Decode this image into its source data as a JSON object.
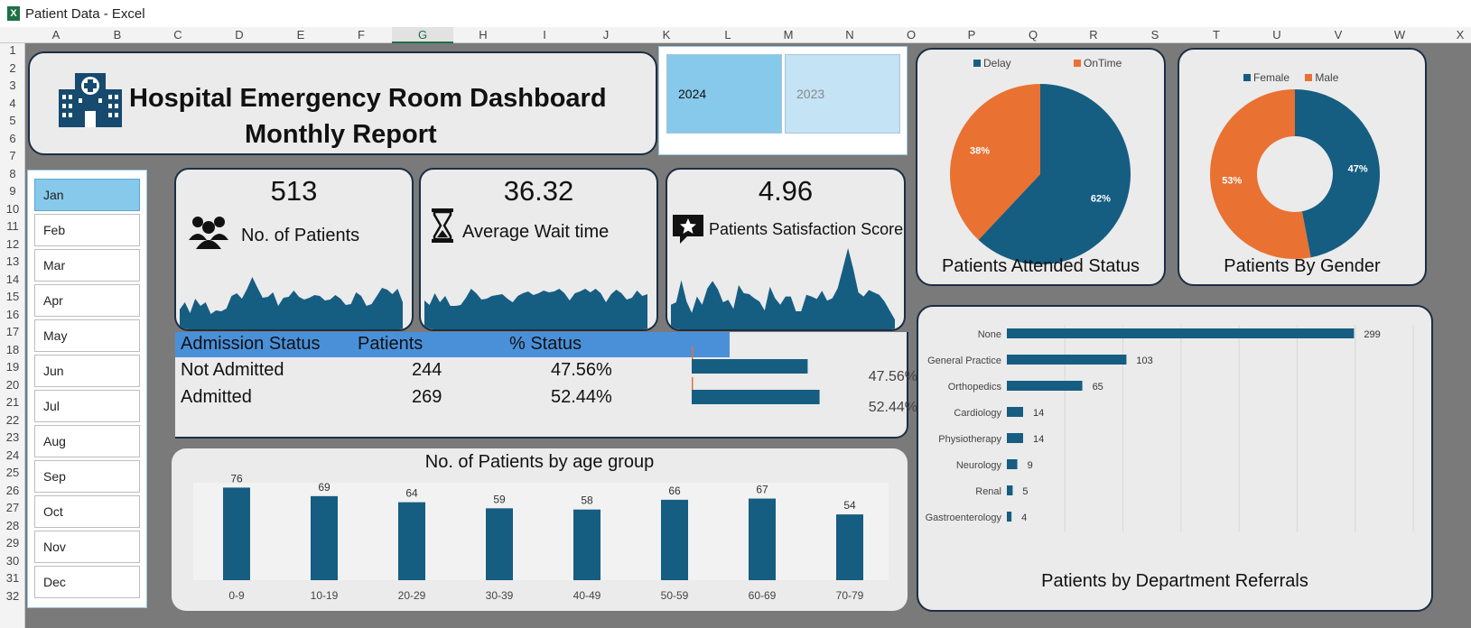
{
  "window": {
    "app_icon": "X",
    "title": "Patient  Data - Excel"
  },
  "columns": [
    "A",
    "B",
    "C",
    "D",
    "E",
    "F",
    "G",
    "H",
    "I",
    "J",
    "K",
    "L",
    "M",
    "N",
    "O",
    "P",
    "Q",
    "R",
    "S",
    "T",
    "U",
    "V",
    "W",
    "X"
  ],
  "rows": [
    "1",
    "2",
    "3",
    "4",
    "5",
    "6",
    "7",
    "8",
    "9",
    "10",
    "11",
    "12",
    "13",
    "14",
    "15",
    "16",
    "17",
    "18",
    "19",
    "20",
    "21",
    "22",
    "23",
    "24",
    "25",
    "26",
    "27",
    "28",
    "29",
    "30",
    "31",
    "32"
  ],
  "selected_column": "G",
  "header": {
    "title_line1": "Hospital Emergency Room Dashboard",
    "title_line2": "Monthly Report",
    "logo_icon": "hospital-icon"
  },
  "year_slicer": {
    "selected": "2024",
    "other": "2023"
  },
  "months": [
    "Jan",
    "Feb",
    "Mar",
    "Apr",
    "May",
    "Jun",
    "Jul",
    "Aug",
    "Sep",
    "Oct",
    "Nov",
    "Dec"
  ],
  "selected_month": "Jan",
  "kpis": {
    "patients": {
      "value": "513",
      "label": "No. of Patients",
      "icon": "people-icon"
    },
    "wait": {
      "value": "36.32",
      "label": "Average Wait time",
      "icon": "hourglass-icon"
    },
    "satisfaction": {
      "value": "4.96",
      "label": "Patients Satisfaction Score",
      "icon": "star-speech-icon"
    }
  },
  "colors": {
    "navy": "#165d82",
    "orange": "#e97132",
    "blue_header": "#4a90d9",
    "slicer_selected": "#87c9ea"
  },
  "admission": {
    "headers": [
      "Admission Status",
      "Patients",
      "% Status"
    ],
    "rows": [
      {
        "status": "Not Admitted",
        "patients": "244",
        "pct": "47.56%",
        "fraction": 0.4756
      },
      {
        "status": "Admitted",
        "patients": "269",
        "pct": "52.44%",
        "fraction": 0.5244
      }
    ]
  },
  "chart_data": [
    {
      "type": "area",
      "series": [
        {
          "values": [
            22,
            30,
            18,
            34,
            26,
            30,
            17,
            21,
            20,
            23,
            37,
            40,
            34,
            45,
            58,
            46,
            35,
            36,
            41,
            26,
            35,
            36,
            43,
            36,
            33,
            35,
            38,
            37,
            32,
            33,
            38,
            34,
            27,
            28,
            41,
            37,
            26,
            28,
            37,
            46,
            44,
            39,
            45,
            30
          ]
        }
      ]
    },
    {
      "type": "area",
      "series": [
        {
          "values": [
            32,
            27,
            40,
            30,
            37,
            26,
            26,
            27,
            35,
            45,
            40,
            33,
            34,
            37,
            38,
            39,
            34,
            30,
            37,
            40,
            42,
            38,
            40,
            43,
            41,
            42,
            45,
            40,
            32,
            40,
            42,
            45,
            41,
            45,
            40,
            30,
            39,
            44,
            40,
            33,
            35,
            43,
            37,
            39
          ]
        }
      ]
    },
    {
      "type": "area",
      "series": [
        {
          "values": [
            30,
            33,
            60,
            34,
            20,
            40,
            30,
            50,
            59,
            49,
            33,
            36,
            25,
            54,
            44,
            43,
            38,
            34,
            23,
            52,
            38,
            30,
            40,
            40,
            22,
            22,
            42,
            40,
            37,
            47,
            35,
            38,
            50,
            74,
            99,
            74,
            45,
            40,
            48,
            45,
            42,
            34,
            23,
            12
          ]
        }
      ]
    },
    {
      "type": "pie",
      "title": "Patients Attended Status",
      "series": [
        {
          "name": "Delay",
          "value": 62,
          "label": "62%"
        },
        {
          "name": "OnTime",
          "value": 38,
          "label": "38%"
        }
      ]
    },
    {
      "type": "pie",
      "title": "Patients By Gender",
      "series": [
        {
          "name": "Female",
          "value": 47,
          "label": "47%"
        },
        {
          "name": "Male",
          "value": 53,
          "label": "53%"
        }
      ]
    },
    {
      "type": "bar",
      "title": "No. of Patients by age group",
      "categories": [
        "0-9",
        "10-19",
        "20-29",
        "30-39",
        "40-49",
        "50-59",
        "60-69",
        "70-79"
      ],
      "values": [
        76,
        69,
        64,
        59,
        58,
        66,
        67,
        54
      ],
      "ylim": [
        0,
        80
      ]
    },
    {
      "type": "bar",
      "title": "Patients by Department Referrals",
      "categories": [
        "None",
        "General Practice",
        "Orthopedics",
        "Cardiology",
        "Physiotherapy",
        "Neurology",
        "Renal",
        "Gastroenterology"
      ],
      "values": [
        299,
        103,
        65,
        14,
        14,
        9,
        5,
        4
      ],
      "xlim": [
        0,
        350
      ]
    }
  ]
}
